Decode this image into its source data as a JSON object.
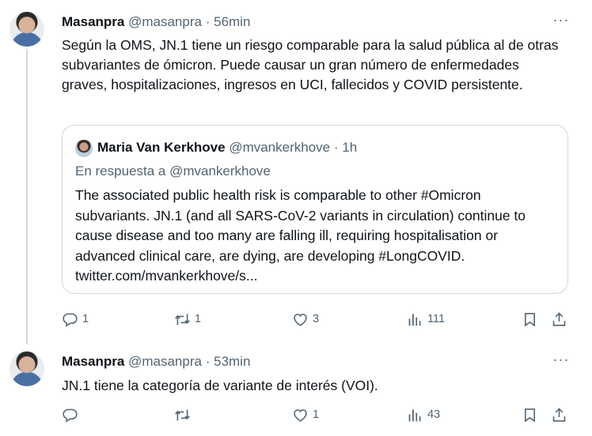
{
  "tweets": [
    {
      "name": "Masanpra",
      "handle": "@masanpra",
      "sep": "·",
      "time": "56min",
      "text": "Según la OMS, JN.1 tiene un riesgo comparable para la salud pública al de otras subvariantes de ómicron. Puede causar un gran número de enfermedades graves, hospitalizaciones, ingresos en UCI, fallecidos y COVID persistente.",
      "quote": {
        "name": "Maria Van Kerkhove",
        "handle": "@mvankerkhove",
        "sep": "·",
        "time": "1h",
        "reply_to": "En respuesta a @mvankerkhove",
        "text": "The associated public health risk is comparable to other #Omicron subvariants. JN.1 (and all SARS-CoV-2 variants in circulation) continue to cause disease and too many are falling ill, requiring hospitalisation or advanced clinical care, are dying, are developing #LongCOVID. twitter.com/mvankerkhove/s..."
      },
      "replies": "1",
      "retweets": "1",
      "likes": "3",
      "views": "111"
    },
    {
      "name": "Masanpra",
      "handle": "@masanpra",
      "sep": "·",
      "time": "53min",
      "text": "JN.1 tiene la categoría de variante de interés (VOI).",
      "replies": "",
      "retweets": "",
      "likes": "1",
      "views": "43"
    }
  ],
  "icons": {
    "more": "more-horizontal-icon",
    "reply": "reply-icon",
    "retweet": "retweet-icon",
    "like": "heart-icon",
    "views": "views-icon",
    "bookmark": "bookmark-icon",
    "share": "share-icon"
  },
  "colors": {
    "text": "#0f1419",
    "secondary": "#536471",
    "border": "#cfd9de"
  }
}
